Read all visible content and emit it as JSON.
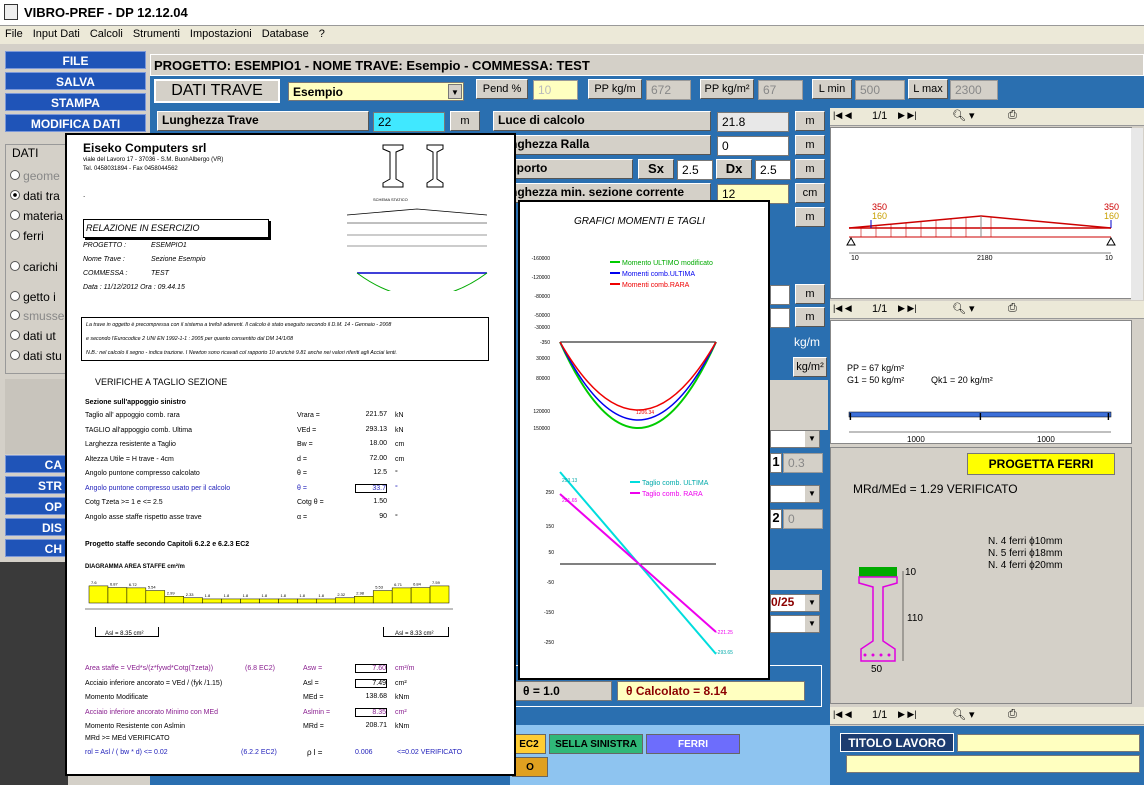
{
  "app": {
    "title": "VIBRO-PREF - DP 12.12.04"
  },
  "menu": [
    "File",
    "Input Dati",
    "Calcoli",
    "Strumenti",
    "Impostazioni",
    "Database",
    "?"
  ],
  "left": {
    "buttons": [
      "FILE",
      "SALVA",
      "STAMPA",
      "MODIFICA DATI"
    ],
    "group_title": "DATI",
    "radios": [
      "geome",
      "dati tra",
      "materia",
      "ferri",
      "carichi",
      "getto i",
      "smusse",
      "dati ut",
      "dati stu"
    ],
    "lower": [
      "CA",
      "STR",
      "OP",
      "DIS",
      "CH"
    ]
  },
  "header": {
    "text": "PROGETTO: ESEMPIO1 - NOME TRAVE: Esempio - COMMESSA: TEST"
  },
  "dati_trave": {
    "title": "DATI TRAVE",
    "select": "Esempio",
    "pend_label": "Pend %",
    "pend": "10",
    "pp1_label": "PP kg/m",
    "pp1": "672",
    "pp2_label": "PP kg/m²",
    "pp2": "67",
    "lmin_label": "L min",
    "lmin": "500",
    "lmax_label": "L max",
    "lmax": "2300"
  },
  "form": {
    "lunghezza": {
      "label": "Lunghezza Trave",
      "value": "22",
      "unit": "m"
    },
    "luce": {
      "label": "Luce di calcolo",
      "value": "21.8",
      "unit": "m"
    },
    "ralla": {
      "label": "nghezza Ralla",
      "value": "0",
      "unit": "m"
    },
    "appoggio": {
      "label": "sporto",
      "sx_label": "Sx",
      "sx": "2.5",
      "dx_label": "Dx",
      "dx": "2.5",
      "unit": "m"
    },
    "sezione": {
      "label": "nghezza min. sezione corrente",
      "value": "12",
      "unit": "cm"
    },
    "unit_m": "m",
    "unit_kgm": "kg/m",
    "unit_kgm2": "kg/m²",
    "val03": "0.3",
    "val1": "1",
    "val2": "2",
    "val0": "0",
    "rck": "0/25",
    "theta_label": "θ = 1.0",
    "theta_calc": "θ  Calcolato =  8.14",
    "btn_ec2": "EC2",
    "btn_sella": "SELLA SINISTRA",
    "btn_ferri": "FERRI",
    "btn_o": "O",
    "titolo_label": "TITOLO LAVORO"
  },
  "right": {
    "pager": "1/1",
    "p1": {
      "loads": [
        "350",
        "160",
        "350",
        "160"
      ],
      "span": "2180",
      "ends": [
        "10",
        "10"
      ]
    },
    "p2": {
      "pp": "PP = 67 kg/m²",
      "g1": "G1 = 50 kg/m²",
      "qk1": "Qk1 = 20 kg/m²",
      "spans": [
        "1000",
        "1000"
      ]
    },
    "p3": {
      "btn": "PROGETTA FERRI",
      "verify": "MRd/MEd = 1.29 VERIFICATO",
      "ferri": [
        "N. 4 ferri ϕ10mm",
        "N. 5 ferri ϕ18mm",
        "N. 4 ferri ϕ20mm"
      ],
      "dims": [
        "10",
        "110",
        "50"
      ]
    }
  },
  "report": {
    "company": "Eiseko Computers srl",
    "address": "viale del Lavoro 17 - 37036 - S.M. BuonAlbergo (VR)",
    "phone": "Tel. 0458031894 - Fax 0458044562",
    "dot": ".",
    "schema": "SCHEMA STATICO",
    "box_title": "RELAZIONE IN ESERCIZIO",
    "info": [
      {
        "k": "PROGETTO :",
        "v": "ESEMPIO1"
      },
      {
        "k": "Nome Trave :",
        "v": "Sezione Esempio"
      },
      {
        "k": "COMMESSA :",
        "v": "TEST"
      }
    ],
    "date": "Data :  11/12/2012   Ora :  09.44.15",
    "notes": [
      "La trave in oggetto è precompressa con il sistema a trefoli aderenti. Il calcolo è stato eseguito secondo il D.M. 14 - Gennaio - 2008",
      "e secondo l'Eurocodice 2 UNI EN 1992-1-1 : 2005 per quanto consentito dal DM 14/1/08",
      "N.B.: nel calcolo il segno - indica trazione. I Newton sono ricavati col rapporto 10 anzichè 9.81 anche nei valori riferiti agli Acciai lenti."
    ],
    "section_title": "VERIFICHE A TAGLIO SEZIONE",
    "sub": "Sezione sull'appoggio sinistro",
    "rows": [
      {
        "l": "Taglio all' appoggio comb. rara",
        "s": "Vrara =",
        "v": "221.57",
        "u": "kN"
      },
      {
        "l": "TAGLIO all'appoggio comb. Ultima",
        "s": "VEd =",
        "v": "293.13",
        "u": "kN"
      },
      {
        "l": "Larghezza resistente a Taglio",
        "s": "Bw =",
        "v": "18.00",
        "u": "cm"
      },
      {
        "l": "Altezza Utile = H trave - 4cm",
        "s": "d =",
        "v": "72.00",
        "u": "cm"
      },
      {
        "l": "Angolo puntone compresso calcolato",
        "s": "θ =",
        "v": "12.5",
        "u": "°"
      },
      {
        "l": "Angolo puntone compresso usato per il calcolo",
        "s": "θ =",
        "v": "33.7",
        "u": "°"
      },
      {
        "l": "Cotg Tzeta >= 1 e <= 2.5",
        "s": "Cotg θ =",
        "v": "1.50",
        "u": ""
      },
      {
        "l": "Angolo asse staffe rispetto asse trave",
        "s": "α =",
        "v": "90",
        "u": "°"
      }
    ],
    "staffe_title": "Progetto staffe secondo Capitoli 6.2.2 e 6.2.3 EC2",
    "diag_title": "DIAGRAMMA AREA STAFFE cm²/m",
    "diag_vals": [
      "7.6",
      "6.87",
      "6.72",
      "5.54",
      "2.99",
      "2.33",
      "1.8",
      "1.8",
      "1.8",
      "1.8",
      "1.8",
      "1.8",
      "1.8",
      "2.32",
      "2.98",
      "5.53",
      "6.71",
      "6.84",
      "7.59"
    ],
    "asl_left": "Asl = 8.35 cm²",
    "asl_right": "Asl = 8.33 cm²",
    "rows2": [
      {
        "l": "Area staffe = VEd*s/(z*fywd*Cotg(Tzeta))",
        "e": "(6.8 EC2)",
        "s": "Asw =",
        "v": "7.60",
        "u": "cm²/m"
      },
      {
        "l": "Acciaio inferiore ancorato = VEd / (fyk /1.15)",
        "e": "",
        "s": "Asl =",
        "v": "7.49",
        "u": "cm²"
      },
      {
        "l": "Momento Modificate",
        "e": "",
        "s": "MEd =",
        "v": "138.68",
        "u": "kNm"
      },
      {
        "l": "Acciaio inferiore ancorato Minimo con MEd",
        "e": "",
        "s": "Aslmin =",
        "v": "8.35",
        "u": "cm²"
      },
      {
        "l": "Momento Resistente con Aslmin",
        "e": "",
        "s": "MRd =",
        "v": "208.71",
        "u": "kNm"
      }
    ],
    "mrd": "MRd >= MEd  VERIFICATO",
    "rol": "rol = Asl / ( bw * d) <= 0.02",
    "rol_ec": "(6.2.2 EC2)",
    "rho": "ρ l =",
    "rho_v": "0.006",
    "rho_ok": "<=0.02 VERIFICATO"
  },
  "graph": {
    "title": "GRAFICI MOMENTI E TAGLI",
    "legend1": [
      "Momento ULTIMO modificato",
      "Momenti comb.ULTIMA",
      "Momenti comb.RARA"
    ],
    "legend2": [
      "Taglio comb. ULTIMA",
      "Taglio comb. RARA"
    ],
    "ticks1": [
      "-160000",
      "-120000",
      "-80000",
      "-50000",
      "-30000",
      "-350",
      "30000",
      "80000",
      "120000",
      "150000"
    ],
    "ticks2": [
      "250",
      "150",
      "50",
      "-50",
      "-150",
      "-250"
    ],
    "mom_labels": [
      "1206.34"
    ],
    "v_labels": [
      "293.13",
      "221.65",
      "-221.25",
      "-293.65"
    ],
    "colors": {
      "green": "#00cc00",
      "blue": "#0000ee",
      "red": "#ee0000",
      "cyan": "#00dddd",
      "magenta": "#ee00ee"
    }
  }
}
